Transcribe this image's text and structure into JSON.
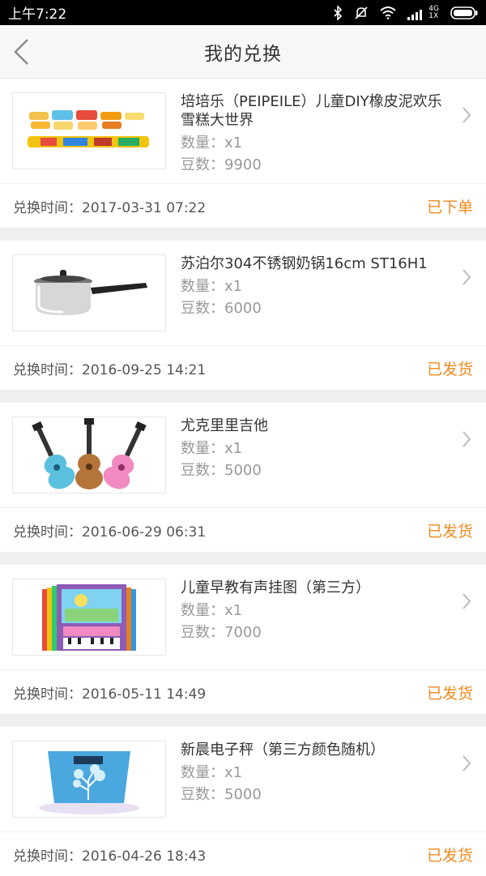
{
  "statusbar": {
    "time": "上午7:22",
    "network": "4G",
    "network_sub": "1X"
  },
  "header": {
    "title": "我的兑换"
  },
  "orders": [
    {
      "name": "培培乐（PEIPEILE）儿童DIY橡皮泥欢乐雪糕大世界",
      "qty": "数量：x1",
      "beans": "豆数：9900",
      "time": "兑换时间：2017-03-31 07:22",
      "status": "已下单",
      "icon": "playdough-product-image"
    },
    {
      "name": "苏泊尔304不锈钢奶锅16cm ST16H1",
      "qty": "数量：x1",
      "beans": "豆数：6000",
      "time": "兑换时间：2016-09-25 14:21",
      "status": "已发货",
      "icon": "milk-pot-product-image"
    },
    {
      "name": "尤克里里吉他",
      "qty": "数量：x1",
      "beans": "豆数：5000",
      "time": "兑换时间：2016-06-29 06:31",
      "status": "已发货",
      "icon": "ukulele-product-image"
    },
    {
      "name": "儿童早教有声挂图（第三方）",
      "qty": "数量：x1",
      "beans": "豆数：7000",
      "time": "兑换时间：2016-05-11 14:49",
      "status": "已发货",
      "icon": "wall-chart-product-image"
    },
    {
      "name": "新晨电子秤（第三方颜色随机）",
      "qty": "数量：x1",
      "beans": "豆数：5000",
      "time": "兑换时间：2016-04-26 18:43",
      "status": "已发货",
      "icon": "scale-product-image"
    }
  ],
  "colors": {
    "accent": "#f08a1c"
  }
}
